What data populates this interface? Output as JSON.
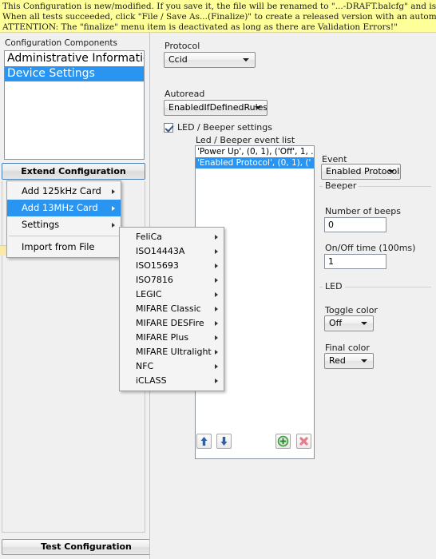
{
  "banner": {
    "lines": [
      "This Configuration is new/modified. If you save it, the file will be renamed to \"...-DRAFT.balcfg\" and is only for temporary usage until it",
      "When all tests succeeded, click \"File / Save As...(Finalize)\" to create a released version with an automatically increased unique version i",
      "ATTENTION: The \"finalize\" menu item is deactivated as long as there are Validation Errors!\""
    ]
  },
  "left_pane": {
    "components_label": "Configuration Components",
    "components": [
      {
        "label": "Administrative Information",
        "selected": false
      },
      {
        "label": "Device Settings",
        "selected": true
      }
    ],
    "extend_button": "Extend Configuration",
    "test_button": "Test Configuration"
  },
  "context_menu": {
    "items": [
      {
        "label": "Add 125kHz Card",
        "has_submenu": true,
        "highlight": false,
        "separator_after": false
      },
      {
        "label": "Add 13MHz Card",
        "has_submenu": true,
        "highlight": true,
        "separator_after": false
      },
      {
        "label": "Settings",
        "has_submenu": true,
        "highlight": false,
        "separator_after": true
      },
      {
        "label": "Import from File",
        "has_submenu": false,
        "highlight": false,
        "separator_after": false
      }
    ]
  },
  "card_submenu": {
    "items": [
      {
        "label": "FeliCa",
        "has_submenu": true
      },
      {
        "label": "ISO14443A",
        "has_submenu": true
      },
      {
        "label": "ISO15693",
        "has_submenu": true
      },
      {
        "label": "ISO7816",
        "has_submenu": true
      },
      {
        "label": "LEGIC",
        "has_submenu": true
      },
      {
        "label": "MIFARE Classic",
        "has_submenu": true
      },
      {
        "label": "MIFARE DESFire",
        "has_submenu": true
      },
      {
        "label": "MIFARE Plus",
        "has_submenu": true
      },
      {
        "label": "MIFARE Ultralight",
        "has_submenu": true
      },
      {
        "label": "NFC",
        "has_submenu": true
      },
      {
        "label": "iCLASS",
        "has_submenu": true
      }
    ]
  },
  "right_pane": {
    "protocol": {
      "label": "Protocol",
      "value": "Ccid"
    },
    "autoread": {
      "label": "Autoread",
      "value": "EnabledIfDefinedRules"
    },
    "led_beeper_settings": {
      "label": "LED / Beeper settings",
      "checked": true
    },
    "event_list": {
      "label": "Led / Beeper event list",
      "rows": [
        {
          "text": "'Power Up', (0, 1), ('Off', 1, ...",
          "selected": false
        },
        {
          "text": "'Enabled Protocol', (0, 1), (' ...",
          "selected": true
        }
      ]
    },
    "list_toolbar": {
      "move_up": "move-up-icon",
      "move_down": "move-down-icon",
      "add": "add-icon",
      "delete": "delete-icon"
    },
    "event": {
      "label": "Event",
      "value": "Enabled Protocol"
    },
    "beeper": {
      "group_title": "Beeper",
      "number_of_beeps_label": "Number of beeps",
      "number_of_beeps_value": "0",
      "onoff_time_label": "On/Off time (100ms)",
      "onoff_time_value": "1"
    },
    "led": {
      "group_title": "LED",
      "toggle_color_label": "Toggle color",
      "toggle_color_value": "Off",
      "final_color_label": "Final color",
      "final_color_value": "Red"
    }
  },
  "colors": {
    "banner_background": "#ffff99",
    "selection_blue": "#2a95f0",
    "window_background": "#f0f0f0",
    "validation_strip": "#fbe9a8",
    "add_icon_green": "#3f9b3f",
    "delete_icon_red": "#e27e8d",
    "arrow_icon_blue": "#2a5fb0"
  }
}
